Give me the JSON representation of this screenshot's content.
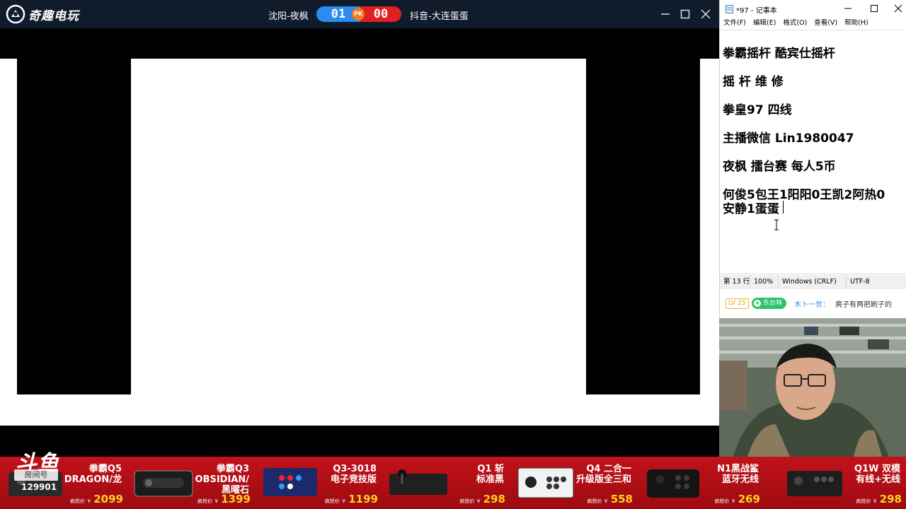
{
  "game_app": {
    "logo_text": "奇趣电玩",
    "player_left": "沈阳-夜枫",
    "player_right": "抖音-大连蛋蛋",
    "score_left": "01",
    "score_right": "00",
    "pk_badge": "PK"
  },
  "notepad": {
    "title": "*97 - 记事本",
    "menu": [
      "文件(F)",
      "编辑(E)",
      "格式(O)",
      "查看(V)",
      "帮助(H)"
    ],
    "lines": [
      "拳霸摇杆 酷宾仕摇杆",
      "摇 杆 维 修",
      "拳皇97 四线",
      "主播微信 Lin1980047",
      " 夜枫 擂台赛  每人5币",
      "何俊5包王1阳阳0王凯2阿热0",
      "安静1蛋蛋"
    ],
    "status": {
      "position": "第 13 行",
      "zoom": "100%",
      "line_ending": "Windows (CRLF)",
      "encoding": "UTF-8"
    }
  },
  "chat": {
    "level": "LV 25",
    "fan_badge": "东台林",
    "user": "木卜一世：",
    "message": "爽子有两把刷子的"
  },
  "douyu": {
    "logo": "斗鱼",
    "label": "房间号",
    "room_number": "129901"
  },
  "products": [
    {
      "name": "拳霸Q5\nDRAGON/龙",
      "price_label": "疯抢价 ￥",
      "price": "2099"
    },
    {
      "name": "拳霸Q3\nOBSIDIAN/\n黑曜石",
      "price_label": "疯抢价 ￥",
      "price": "1399"
    },
    {
      "name": "Q3-3018\n电子竞技版",
      "price_label": "疯抢价 ￥",
      "price": "1199"
    },
    {
      "name": "Q1 斩\n标准黑",
      "price_label": "疯抢价 ￥",
      "price": "298"
    },
    {
      "name": "Q4 二合一\n升级版全三和",
      "price_label": "疯抢价 ￥",
      "price": "558"
    },
    {
      "name": "N1黑战鲨\n蓝牙无线",
      "price_label": "疯抢价 ￥",
      "price": "269"
    },
    {
      "name": "Q1W 双模\n有线+无线",
      "price_label": "疯抢价 ￥",
      "price": "298"
    }
  ],
  "colors": {
    "titlebar": "#101c2c",
    "score_blue": "#2a8cf0",
    "score_red": "#e02020",
    "banner_red": "#c2121a",
    "price_yellow": "#ffd21a",
    "fan_green": "#2cc36b"
  }
}
